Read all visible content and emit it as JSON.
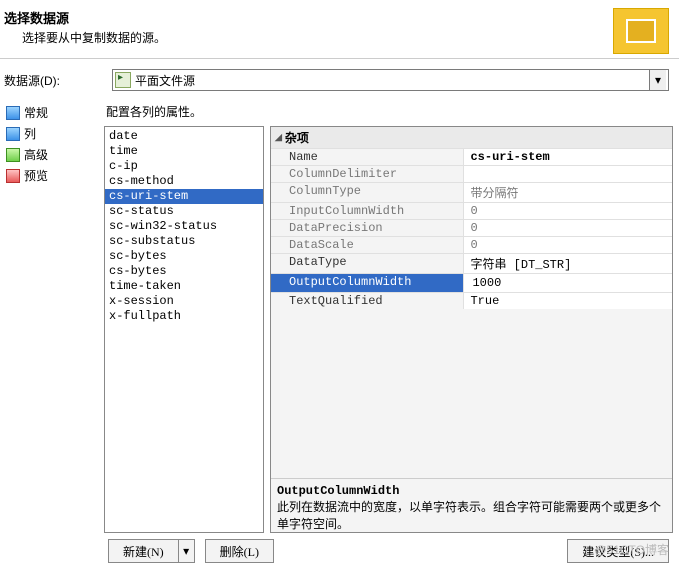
{
  "header": {
    "title": "选择数据源",
    "subtitle": "选择要从中复制数据的源。"
  },
  "datasource": {
    "label": "数据源(D):",
    "value": "平面文件源"
  },
  "nav": {
    "items": [
      {
        "label": "常规"
      },
      {
        "label": "列"
      },
      {
        "label": "高级"
      },
      {
        "label": "预览"
      }
    ]
  },
  "hint": "配置各列的属性。",
  "columns": [
    "date",
    "time",
    "c-ip",
    "cs-method",
    "cs-uri-stem",
    "sc-status",
    "sc-win32-status",
    "sc-substatus",
    "sc-bytes",
    "cs-bytes",
    "time-taken",
    "x-session",
    "x-fullpath"
  ],
  "columns_selected_index": 4,
  "prop": {
    "category": "杂项",
    "rows": [
      {
        "name": "Name",
        "value": "cs-uri-stem",
        "bold": true
      },
      {
        "name": "ColumnDelimiter",
        "value": "",
        "gray": true
      },
      {
        "name": "ColumnType",
        "value": "带分隔符",
        "gray": true
      },
      {
        "name": "InputColumnWidth",
        "value": "0",
        "gray": true
      },
      {
        "name": "DataPrecision",
        "value": "0",
        "gray": true
      },
      {
        "name": "DataScale",
        "value": "0",
        "gray": true
      },
      {
        "name": "DataType",
        "value": "字符串 [DT_STR]"
      },
      {
        "name": "OutputColumnWidth",
        "value": "1000",
        "selected": true
      },
      {
        "name": "TextQualified",
        "value": "True"
      }
    ],
    "desc": {
      "title": "OutputColumnWidth",
      "text": "此列在数据流中的宽度，以单字符表示。组合字符可能需要两个或更多个单字符空间。"
    }
  },
  "buttons": {
    "new": "新建(N)",
    "delete": "删除(L)",
    "suggest": "建议类型(S)..."
  },
  "watermark": "@51CTO博客"
}
